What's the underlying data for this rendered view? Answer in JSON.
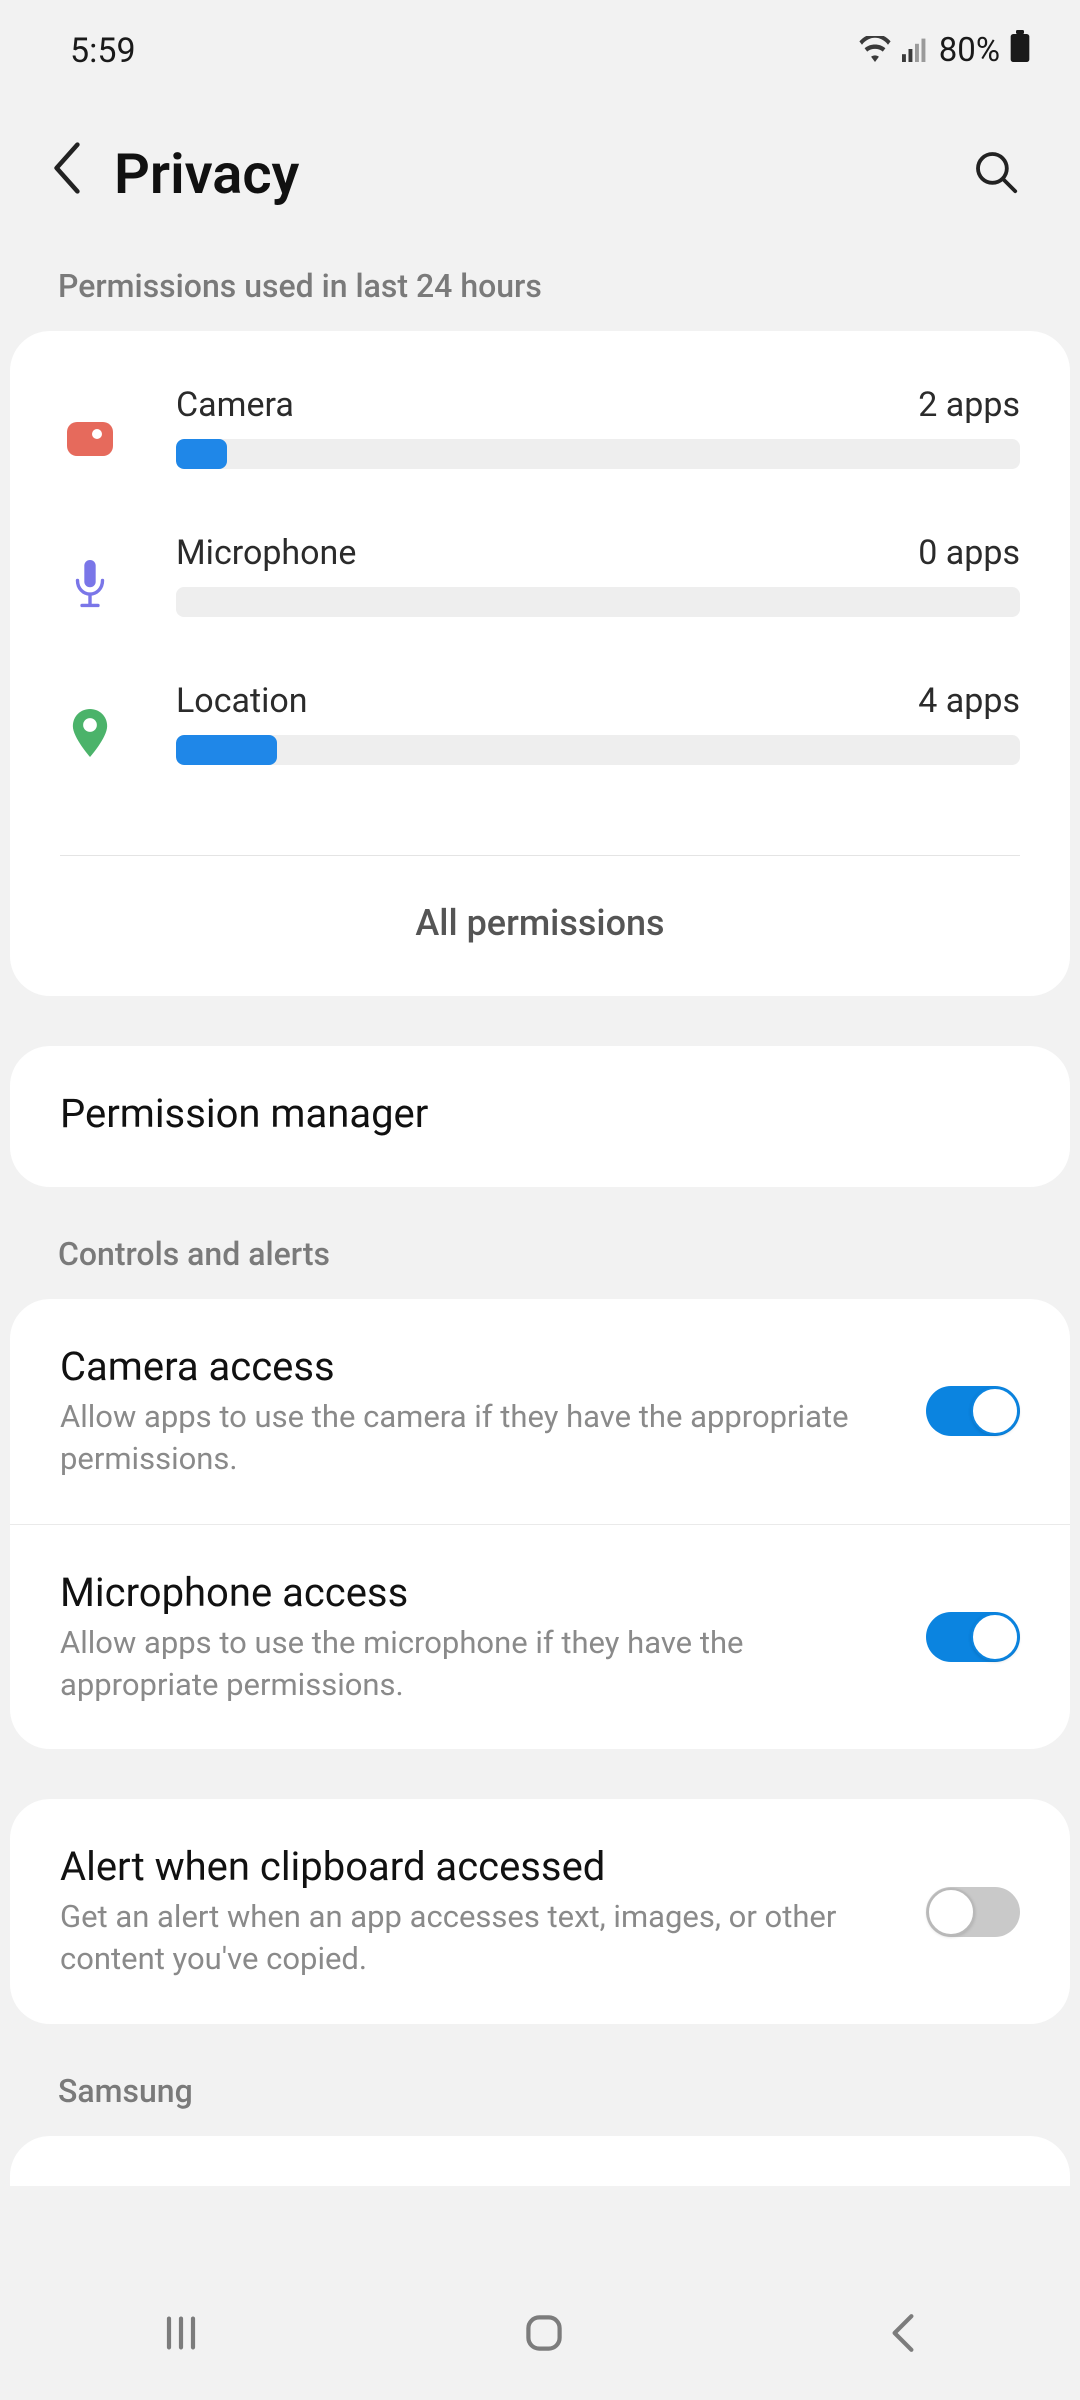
{
  "status": {
    "time": "5:59",
    "battery": "80%"
  },
  "header": {
    "title": "Privacy"
  },
  "sections": {
    "usage_label": "Permissions used in last 24 hours",
    "controls_label": "Controls and alerts",
    "samsung_label": "Samsung"
  },
  "permissions": {
    "camera": {
      "name": "Camera",
      "count": "2 apps",
      "fill_pct": 6
    },
    "microphone": {
      "name": "Microphone",
      "count": "0 apps",
      "fill_pct": 0
    },
    "location": {
      "name": "Location",
      "count": "4 apps",
      "fill_pct": 12
    },
    "all_label": "All permissions"
  },
  "perm_manager": {
    "title": "Permission manager"
  },
  "controls": {
    "camera": {
      "title": "Camera access",
      "sub": "Allow apps to use the camera if they have the appropriate permissions.",
      "on": true
    },
    "mic": {
      "title": "Microphone access",
      "sub": "Allow apps to use the microphone if they have the appropriate permissions.",
      "on": true
    },
    "clipboard": {
      "title": "Alert when clipboard accessed",
      "sub": "Get an alert when an app accesses text, images, or other content you've copied.",
      "on": false
    }
  },
  "samsung_item": {
    "title": ""
  }
}
